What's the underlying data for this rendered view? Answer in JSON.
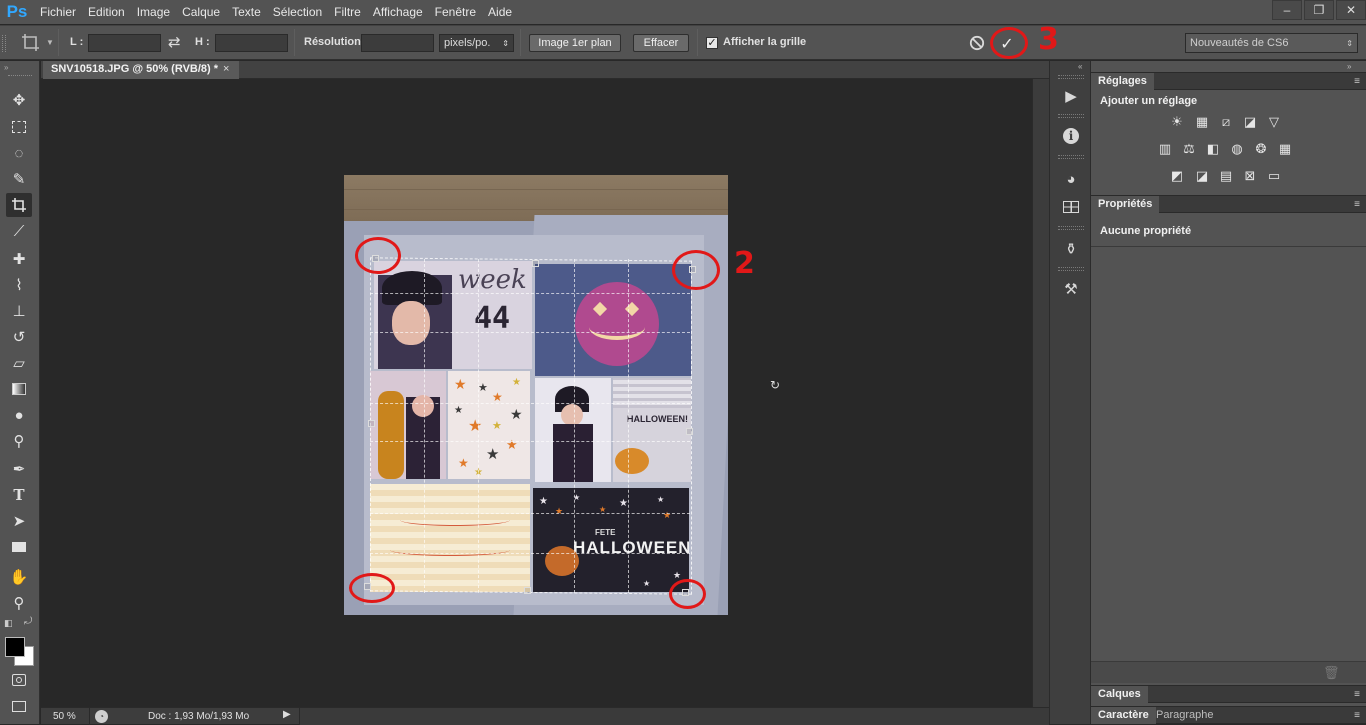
{
  "app": {
    "logo": "Ps"
  },
  "menu": [
    "Fichier",
    "Edition",
    "Image",
    "Calque",
    "Texte",
    "Sélection",
    "Filtre",
    "Affichage",
    "Fenêtre",
    "Aide"
  ],
  "window_controls": {
    "minimize": "–",
    "restore": "❐",
    "close": "✕"
  },
  "options": {
    "width_label": "L :",
    "width_value": "",
    "height_label": "H :",
    "height_value": "",
    "resolution_label": "Résolution :",
    "resolution_value": "",
    "unit_value": "pixels/po.",
    "front_image_button": "Image 1er plan",
    "clear_button": "Effacer",
    "grid_checkbox_label": "Afficher la grille",
    "grid_checked": true,
    "workspace_value": "Nouveautés de CS6",
    "swap_icon": "⇄",
    "cancel_icon": "⃠",
    "commit_icon": "✓"
  },
  "document": {
    "tab_title": "SNV10518.JPG @ 50% (RVB/8) *",
    "tab_close": "×",
    "photo_week_text": "week",
    "photo_number_text": "44",
    "photo_halloween_small": "HALLOWEEN!",
    "photo_fete_text": "FETE",
    "photo_halloween_big": "HALLOWEEN"
  },
  "annotations": {
    "label_2": "2",
    "label_3": "3"
  },
  "status": {
    "zoom": "50 %",
    "doc": "Doc : 1,93 Mo/1,93 Mo"
  },
  "panels": {
    "adjustments_tab": "Réglages",
    "adjustments_heading": "Ajouter un réglage",
    "properties_tab": "Propriétés",
    "properties_text": "Aucune propriété",
    "layers_tab": "Calques",
    "character_tab": "Caractère",
    "paragraph_tab": "Paragraphe"
  },
  "colors": {
    "ps_blue": "#31a8ff",
    "annotation_red": "#e11818",
    "ui_gray": "#535353",
    "canvas_bg": "#282828"
  }
}
